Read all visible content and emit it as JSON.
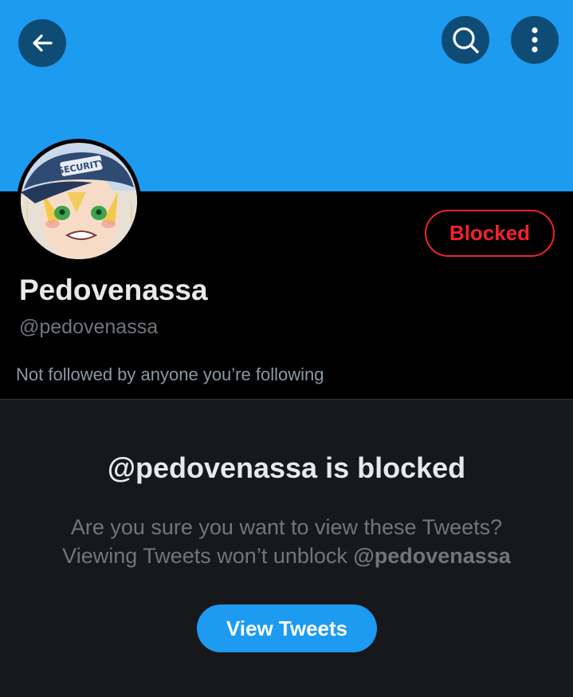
{
  "header": {
    "back_icon": "arrow-left-icon",
    "search_icon": "search-icon",
    "more_icon": "more-vertical-icon"
  },
  "profile": {
    "display_name": "Pedovenassa",
    "handle": "@pedovenassa",
    "follow_context": "Not followed by anyone you’re following",
    "blocked_button_label": "Blocked",
    "avatar_cap_text": "SECURITY"
  },
  "blocked_notice": {
    "title": "@pedovenassa is blocked",
    "line1": "Are you sure you want to view these Tweets?",
    "line2_prefix": "Viewing Tweets won’t unblock ",
    "line2_mention": "@pedovenassa",
    "view_button_label": "View Tweets"
  },
  "colors": {
    "banner": "#1d9bf0",
    "blocked_red": "#f4212e",
    "panel_bg": "#16181c",
    "accent": "#1d9bf0"
  }
}
